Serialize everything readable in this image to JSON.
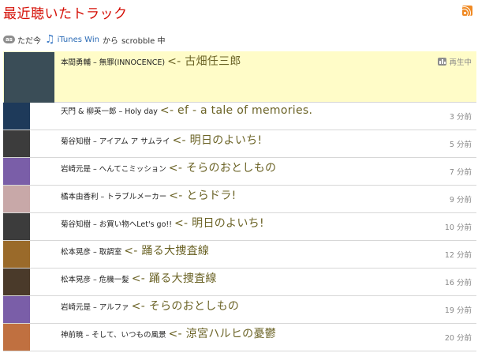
{
  "header": {
    "title": "最近聴いたトラック",
    "rss_icon": "rss-feed-icon"
  },
  "scrobble": {
    "time": "ただ今",
    "client": "iTunes Win",
    "from": "から",
    "status": "scrobble 中"
  },
  "now_playing_label": "再生中",
  "tracks": [
    {
      "artist": "本間勇輔",
      "sep": "–",
      "song": "無罪(INNOCENCE)",
      "note": "<- 古畑任三郎",
      "when": "再生中",
      "art": "#3a4d57"
    },
    {
      "artist": "天門 & 柳英一郎",
      "sep": "–",
      "song": "Holy day",
      "note": "<- ef - a tale of memories.",
      "when": "3 分前",
      "art": "#1e3a5a"
    },
    {
      "artist": "菊谷知樹",
      "sep": "–",
      "song": "アイアム ア サムライ",
      "note": "<- 明日のよいち!",
      "when": "5 分前",
      "art": "#3c3c3c"
    },
    {
      "artist": "岩崎元是",
      "sep": "–",
      "song": "へんてこミッション",
      "note": "<- そらのおとしもの",
      "when": "7 分前",
      "art": "#7a5ea8"
    },
    {
      "artist": "橘本由香利",
      "sep": "–",
      "song": "トラブルメーカー",
      "note": "<- とらドラ!",
      "when": "9 分前",
      "art": "#c8a8a8"
    },
    {
      "artist": "菊谷知樹",
      "sep": "–",
      "song": "お買い物へLet's go!!",
      "note": "<- 明日のよいち!",
      "when": "10 分前",
      "art": "#3c3c3c"
    },
    {
      "artist": "松本晃彦",
      "sep": "–",
      "song": "取調室",
      "note": "<- 踊る大捜査線",
      "when": "12 分前",
      "art": "#9a6a2a"
    },
    {
      "artist": "松本晃彦",
      "sep": "–",
      "song": "危機一髪",
      "note": "<- 踊る大捜査線",
      "when": "16 分前",
      "art": "#4a3a2a"
    },
    {
      "artist": "岩崎元是",
      "sep": "–",
      "song": "アルファ",
      "note": "<- そらのおとしもの",
      "when": "19 分前",
      "art": "#7a5ea8"
    },
    {
      "artist": "神前暁",
      "sep": "–",
      "song": "そして、いつもの風景",
      "note": "<- 涼宮ハルヒの憂鬱",
      "when": "20 分前",
      "art": "#c07040"
    }
  ]
}
